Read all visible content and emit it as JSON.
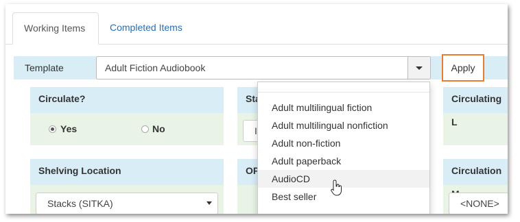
{
  "tabs": [
    {
      "label": "Working Items",
      "active": true
    },
    {
      "label": "Completed Items",
      "active": false
    }
  ],
  "template": {
    "label": "Template",
    "selected": "Adult Fiction Audiobook",
    "apply_label": "Apply"
  },
  "panels": {
    "circulate": {
      "title": "Circulate?",
      "options": [
        {
          "label": "Yes",
          "checked": true
        },
        {
          "label": "No",
          "checked": false
        }
      ]
    },
    "status": {
      "title": "Sta",
      "input_partial": "In"
    },
    "circulating_library": {
      "title": "Circulating L"
    },
    "shelving_location": {
      "title": "Shelving Location",
      "selected": "Stacks (SITKA)"
    },
    "opac": {
      "title": "OP"
    },
    "circulation_modifier": {
      "title": "Circulation M",
      "selected": "<NONE>"
    }
  },
  "dropdown": {
    "items": [
      "Adult multilingual fiction",
      "Adult multilingual nonfiction",
      "Adult non-fiction",
      "Adult paperback",
      "AudioCD",
      "Best seller"
    ],
    "hovered": "AudioCD"
  },
  "colors": {
    "panel_header": "#d9edf7",
    "panel_body": "#eaf4e6",
    "apply_highlight": "#e87e2d",
    "link": "#2a6fb3"
  },
  "icons": [
    "caret-down-icon",
    "hand-pointer-icon"
  ]
}
